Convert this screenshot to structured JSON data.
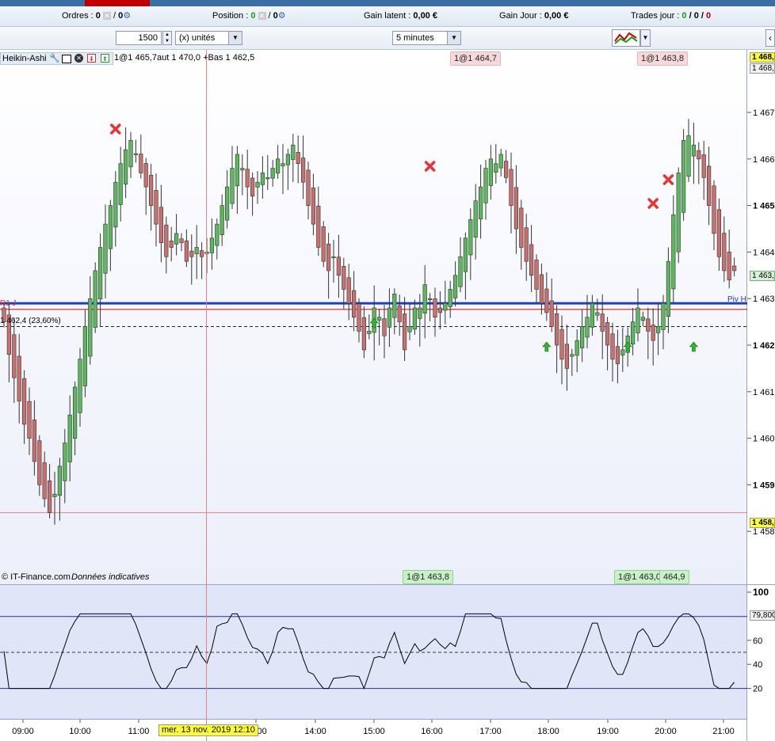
{
  "topbar": {
    "ordres_label": "Ordres :",
    "ordres_value": "0",
    "ordres_value2": "0",
    "position_label": "Position :",
    "position_value": "0",
    "position_value2": "0",
    "gain_latent_label": "Gain latent :",
    "gain_latent_value": "0,00 €",
    "gain_jour_label": "Gain Jour :",
    "gain_jour_value": "0,00 €",
    "trades_label": "Trades jour :",
    "trades_v1": "0",
    "trades_sep1": "/",
    "trades_v2": "0",
    "trades_sep2": "/",
    "trades_v3": "0"
  },
  "toolbar": {
    "quantity": "1500",
    "units": "(x) unités",
    "timeframe": "5 minutes"
  },
  "indicator": {
    "name": "Heikin-Ashi",
    "ohlc_text": "1@1 465,7aut 1 470,0 +Bas 1 462,5"
  },
  "annotations": {
    "fib_label": "1 462,4 (23,60%)",
    "r1_label": "R1 J",
    "piv_label": "Piv H",
    "copyright": "© IT-Finance.com",
    "disclaimer": "Données indicatives",
    "crosshair_time": "mer. 13 nov. 2019 12:10",
    "fill_top_1": "1@1 464,7",
    "fill_top_2": "1@1 463,8",
    "fill_bottom_1": "1@1 463,8",
    "fill_bottom_2": "1@1 463,0",
    "fill_bottom_3": "464,9"
  },
  "price_labels": {
    "yellow_top": "1 468,",
    "grey_top": "1 468,",
    "current": "1 463,",
    "yellow_bottom": "1 458,"
  },
  "colors": {
    "bull": "#5cb85c",
    "bear": "#c9706f",
    "pivot_line": "#1f3fbf",
    "r1_line": "#e0302a",
    "chart_bg_top": "#ffffff",
    "chart_bg_bottom": "#eef1fb",
    "rsi_bg": "#e2e8f8"
  },
  "chart_data": [
    {
      "type": "candlestick",
      "subtype": "heikin-ashi",
      "title": "",
      "y_ticks": [
        "1 467",
        "1 466",
        "1 465",
        "1 464",
        "1 463",
        "1 462",
        "1 461",
        "1 460",
        "1 459",
        "1 458"
      ],
      "x_ticks": [
        "09:00",
        "10:00",
        "11:00",
        "12:00",
        "14:00",
        "15:00",
        "16:00",
        "17:00",
        "18:00",
        "19:00",
        "20:00",
        "21:00"
      ],
      "ylim": [
        1457.8,
        1468.3
      ],
      "levels": {
        "pivot": 1462.9,
        "r1": 1462.77,
        "fib_23_6": 1462.4,
        "crosshair_h": 1458.4
      },
      "candles_close": [
        1462.5,
        1461.8,
        1461.3,
        1460.8,
        1460.3,
        1460.0,
        1459.5,
        1459.0,
        1458.7,
        1458.4,
        1458.8,
        1459.4,
        1459.9,
        1460.5,
        1461.1,
        1461.7,
        1462.4,
        1463.0,
        1463.6,
        1464.1,
        1464.6,
        1465.0,
        1465.5,
        1465.9,
        1466.2,
        1466.4,
        1466.1,
        1465.7,
        1465.4,
        1465.0,
        1464.6,
        1464.2,
        1463.9,
        1464.1,
        1464.4,
        1464.2,
        1463.8,
        1463.9,
        1464.1,
        1463.9,
        1464.0,
        1464.3,
        1464.6,
        1465.0,
        1465.4,
        1465.8,
        1466.1,
        1465.8,
        1465.4,
        1465.2,
        1465.5,
        1465.7,
        1465.6,
        1465.8,
        1466.0,
        1465.9,
        1466.1,
        1466.3,
        1465.9,
        1465.5,
        1465.0,
        1464.6,
        1464.1,
        1463.8,
        1463.6,
        1463.9,
        1463.5,
        1463.2,
        1462.9,
        1462.6,
        1462.3,
        1461.9,
        1462.3,
        1462.8,
        1462.6,
        1462.2,
        1462.8,
        1463.1,
        1462.5,
        1461.9,
        1462.4,
        1462.8,
        1462.8,
        1463.3,
        1463.0,
        1462.6,
        1462.7,
        1462.9,
        1463.2,
        1463.5,
        1463.9,
        1464.3,
        1464.7,
        1465.1,
        1465.4,
        1465.8,
        1466.0,
        1465.9,
        1466.1,
        1465.6,
        1465.0,
        1464.5,
        1464.1,
        1463.8,
        1463.5,
        1463.2,
        1462.9,
        1462.7,
        1462.4,
        1462.0,
        1461.7,
        1461.5,
        1461.8,
        1462.1,
        1462.4,
        1462.6,
        1462.9,
        1462.7,
        1462.3,
        1462.0,
        1461.7,
        1461.6,
        1461.9,
        1462.2,
        1462.5,
        1462.8,
        1462.6,
        1462.3,
        1462.1,
        1462.4,
        1462.9,
        1463.8,
        1464.8,
        1465.7,
        1466.4,
        1466.5,
        1466.3,
        1466.0,
        1465.6,
        1465.0,
        1464.4,
        1463.9,
        1463.6,
        1463.4,
        1463.6
      ],
      "buy_markers_x": [
        73,
        107,
        123,
        136
      ],
      "sell_markers_x": [
        22,
        84,
        128,
        131
      ]
    },
    {
      "type": "line",
      "title": "",
      "y_ticks": [
        "100",
        "60",
        "40",
        "20"
      ],
      "levels": {
        "upper": 79.8,
        "mid": 50,
        "lower": 20
      },
      "ylim": [
        0,
        100
      ],
      "current_label": "79,800"
    }
  ]
}
